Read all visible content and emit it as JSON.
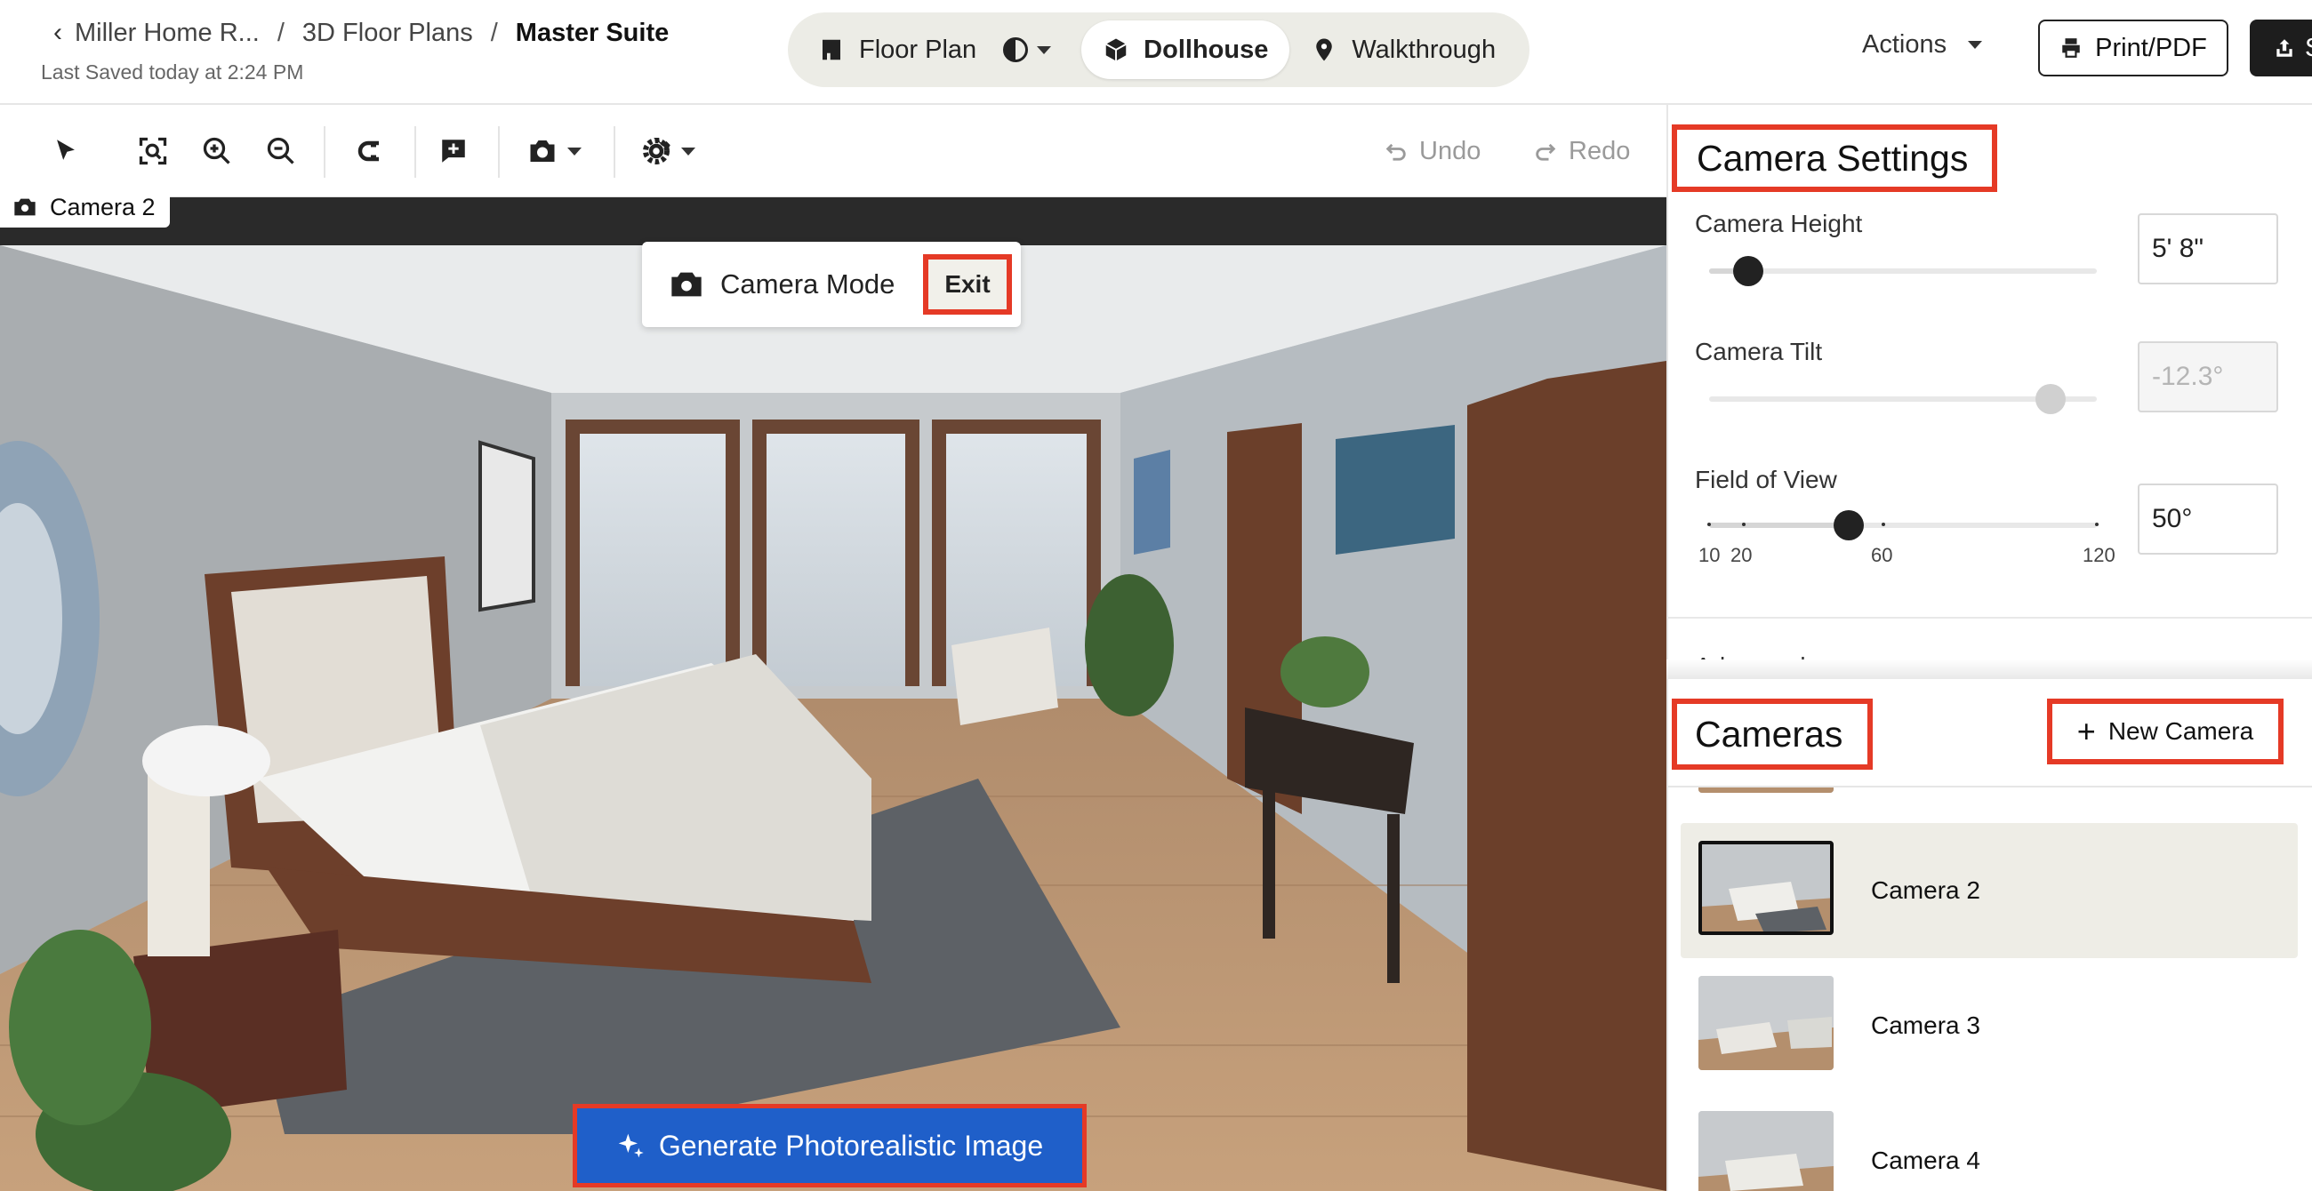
{
  "header": {
    "back_label": "Miller Home R...",
    "crumb_2": "3D Floor Plans",
    "crumb_current": "Master Suite",
    "saved_text": "Last Saved today at 2:24 PM",
    "views": {
      "floor_plan": "Floor Plan",
      "dollhouse": "Dollhouse",
      "walkthrough": "Walkthrough",
      "active": "Dollhouse"
    },
    "actions_label": "Actions",
    "print_label": "Print/PDF",
    "share_label": "S"
  },
  "toolbar": {
    "undo_label": "Undo",
    "redo_label": "Redo",
    "icons": [
      "select-icon",
      "fit-view-icon",
      "zoom-in-icon",
      "zoom-out-icon",
      "magnet-icon",
      "add-label-icon",
      "camera-icon",
      "gear-icon"
    ]
  },
  "viewport": {
    "camera_tag": "Camera 2",
    "camera_mode_label": "Camera Mode",
    "exit_label": "Exit",
    "generate_label": "Generate Photorealistic Image"
  },
  "camera_settings": {
    "title": "Camera Settings",
    "height": {
      "label": "Camera Height",
      "value": "5' 8\"",
      "slider_fraction": 0.1
    },
    "tilt": {
      "label": "Camera Tilt",
      "value": "-12.3°",
      "slider_fraction": 0.88,
      "disabled": true
    },
    "fov": {
      "label": "Field of View",
      "value": "50°",
      "min": 10,
      "max": 120,
      "current": 50,
      "ticks": [
        "10",
        "20",
        "60",
        "120"
      ]
    },
    "advanced_label": "Advanced"
  },
  "cameras": {
    "title": "Cameras",
    "new_camera_label": "New Camera",
    "items": [
      {
        "name": "Camera 2",
        "selected": true
      },
      {
        "name": "Camera 3",
        "selected": false
      },
      {
        "name": "Camera 4",
        "selected": false
      }
    ]
  },
  "colors": {
    "accent_highlight": "#e53a26",
    "primary_button": "#1f5fc9",
    "selected_row": "#eeede6",
    "view_switch_bg": "#ecece6"
  }
}
